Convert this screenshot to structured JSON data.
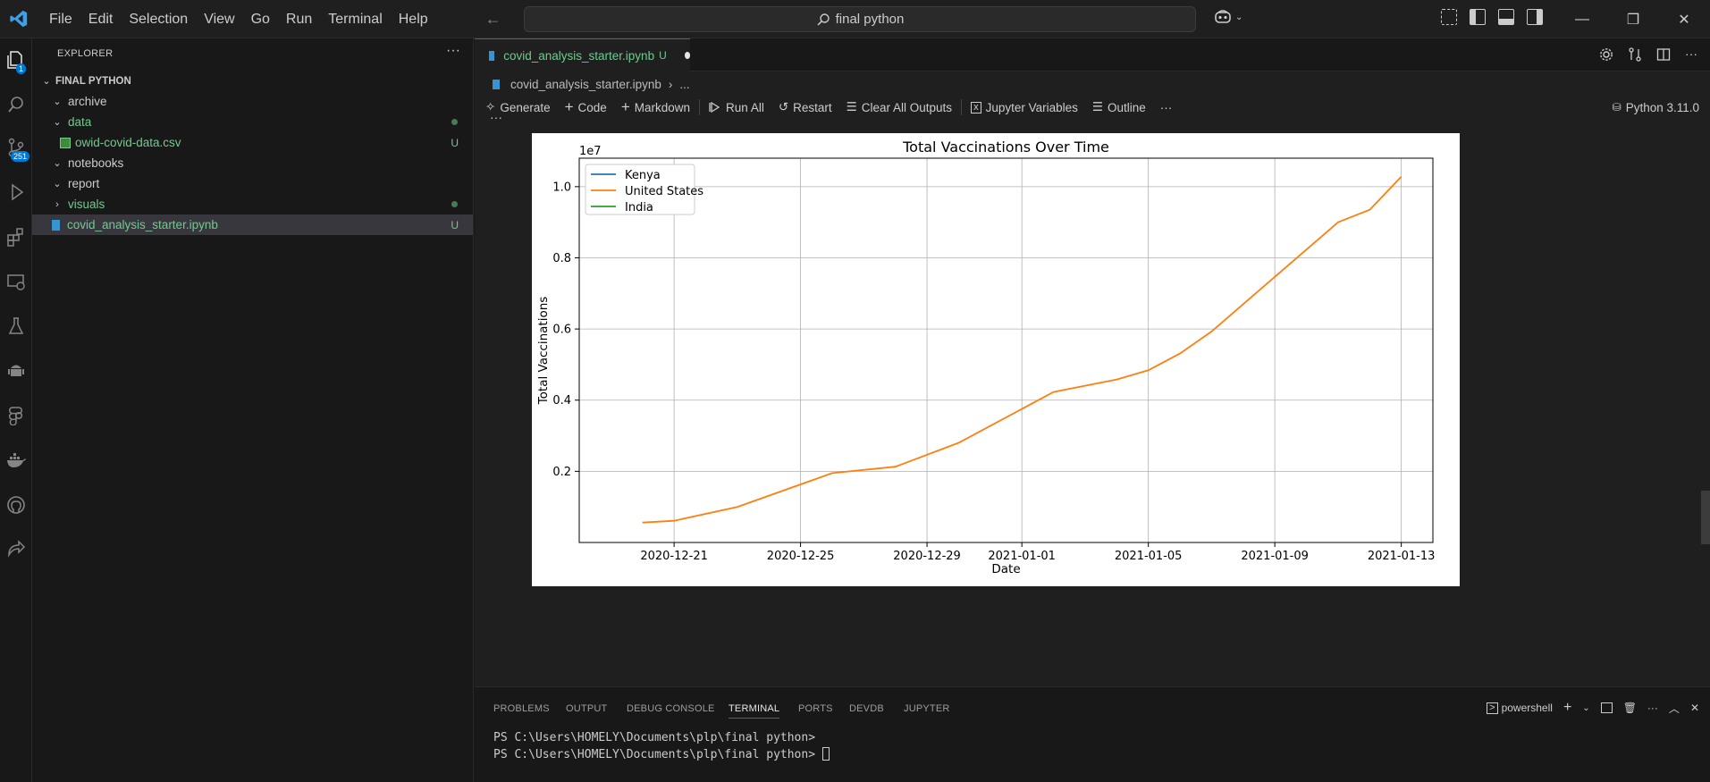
{
  "menu": [
    "File",
    "Edit",
    "Selection",
    "View",
    "Go",
    "Run",
    "Terminal",
    "Help"
  ],
  "search": {
    "text": "final python"
  },
  "activity": {
    "explorer_badge": "1",
    "scm_badge": "251"
  },
  "sidebar": {
    "title": "EXPLORER",
    "root": "FINAL PYTHON",
    "items": [
      {
        "label": "archive"
      },
      {
        "label": "data"
      },
      {
        "label": "owid-covid-data.csv",
        "status": "U"
      },
      {
        "label": "notebooks"
      },
      {
        "label": "report"
      },
      {
        "label": "visuals"
      },
      {
        "label": "covid_analysis_starter.ipynb",
        "status": "U"
      }
    ]
  },
  "tab": {
    "label": "covid_analysis_starter.ipynb",
    "status": "U"
  },
  "breadcrumb": {
    "file": "covid_analysis_starter.ipynb",
    "more": "..."
  },
  "toolbar": {
    "generate": "Generate",
    "code": "Code",
    "markdown": "Markdown",
    "run_all": "Run All",
    "restart": "Restart",
    "clear": "Clear All Outputs",
    "variables": "Jupyter Variables",
    "outline": "Outline",
    "more": "···",
    "kernel": "Python 3.11.0"
  },
  "cell": {
    "more": "···"
  },
  "chart_data": {
    "type": "line",
    "title": "Total Vaccinations Over Time",
    "xlabel": "Date",
    "ylabel": "Total Vaccinations",
    "y_offset_label": "1e7",
    "x_ticks": [
      "2020-12-21",
      "2020-12-25",
      "2020-12-29",
      "2021-01-01",
      "2021-01-05",
      "2021-01-09",
      "2021-01-13"
    ],
    "y_ticks": [
      "0.2",
      "0.4",
      "0.6",
      "0.8",
      "1.0"
    ],
    "xlim": [
      "2020-12-18",
      "2021-01-14"
    ],
    "ylim": [
      0,
      1.08
    ],
    "legend_position": "top-left",
    "grid": true,
    "series": [
      {
        "name": "Kenya",
        "color": "#1f77b4",
        "points": []
      },
      {
        "name": "United States",
        "color": "#ff7f0e",
        "points": [
          [
            "2020-12-20",
            0.056
          ],
          [
            "2020-12-21",
            0.061
          ],
          [
            "2020-12-23",
            0.1
          ],
          [
            "2020-12-26",
            0.195
          ],
          [
            "2020-12-28",
            0.213
          ],
          [
            "2020-12-30",
            0.28
          ],
          [
            "2021-01-02",
            0.423
          ],
          [
            "2021-01-04",
            0.458
          ],
          [
            "2021-01-05",
            0.484
          ],
          [
            "2021-01-06",
            0.531
          ],
          [
            "2021-01-07",
            0.593
          ],
          [
            "2021-01-11",
            0.9
          ],
          [
            "2021-01-12",
            0.935
          ],
          [
            "2021-01-13",
            1.028
          ]
        ]
      },
      {
        "name": "India",
        "color": "#2ca02c",
        "points": []
      }
    ]
  },
  "panel": {
    "tabs": [
      "PROBLEMS",
      "OUTPUT",
      "DEBUG CONSOLE",
      "TERMINAL",
      "PORTS",
      "DEVDB",
      "JUPYTER"
    ],
    "shell": "powershell",
    "lines": [
      "PS C:\\Users\\HOMELY\\Documents\\plp\\final python> ",
      "PS C:\\Users\\HOMELY\\Documents\\plp\\final python> "
    ]
  }
}
